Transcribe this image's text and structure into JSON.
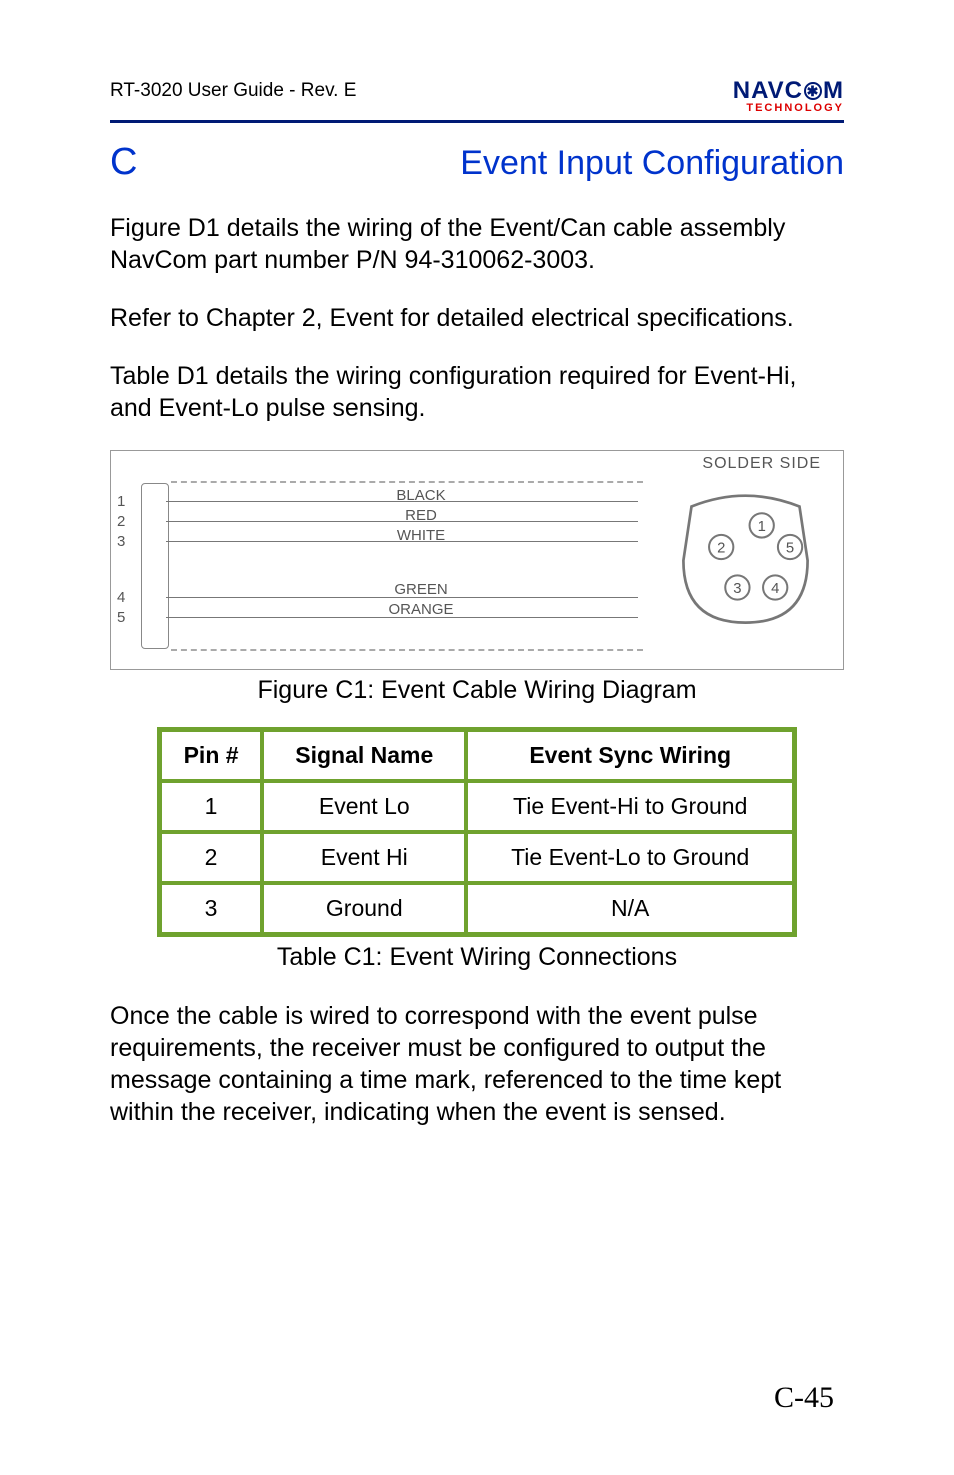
{
  "header": {
    "doc_title": "RT-3020 User Guide - Rev. E",
    "logo_top_a": "NAVC",
    "logo_top_b": "M",
    "logo_bottom": "TECHNOLOGY"
  },
  "section": {
    "letter": "C",
    "title": "Event Input Configuration"
  },
  "para1": "Figure D1 details the wiring of the Event/Can cable assembly NavCom part number P/N 94-310062-3003.",
  "para2": "Refer to Chapter 2, Event for detailed electrical specifications.",
  "para3": "Table D1 details the wiring configuration required for Event-Hi, and Event-Lo pulse sensing.",
  "diagram": {
    "solder_side": "SOLDER SIDE",
    "pins": [
      "1",
      "2",
      "3",
      "4",
      "5"
    ],
    "wires": [
      "BLACK",
      "RED",
      "WHITE",
      "GREEN",
      "ORANGE"
    ],
    "conn_pins": [
      "1",
      "2",
      "3",
      "4",
      "5"
    ]
  },
  "figure_caption": "Figure C1: Event Cable Wiring Diagram",
  "table": {
    "headers": [
      "Pin #",
      "Signal Name",
      "Event Sync Wiring"
    ],
    "rows": [
      [
        "1",
        "Event Lo",
        "Tie Event-Hi to Ground"
      ],
      [
        "2",
        "Event  Hi",
        "Tie Event-Lo to Ground"
      ],
      [
        "3",
        "Ground",
        "N/A"
      ]
    ]
  },
  "table_caption": "Table C1: Event Wiring Connections",
  "para4": "Once the cable is wired to correspond with the event pulse requirements, the receiver must be configured to output the message containing a time mark, referenced to the time kept within the receiver, indicating when the event is sensed.",
  "page_number": "C-45"
}
